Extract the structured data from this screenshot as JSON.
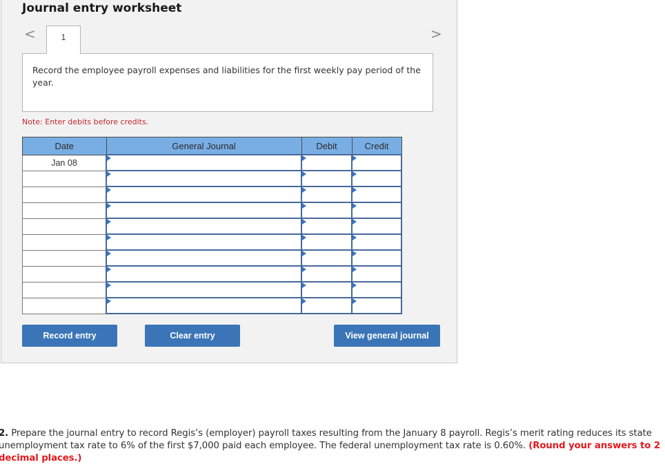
{
  "worksheet": {
    "title": "Journal entry worksheet",
    "nav": {
      "prev_icon": "chevron-left-icon",
      "next_icon": "chevron-right-icon",
      "prev_glyph": "<",
      "next_glyph": ">"
    },
    "tabs": [
      {
        "label": "1",
        "active": true
      }
    ],
    "instruction": "Record the employee payroll expenses and liabilities for the first weekly pay period of the year.",
    "note": "Note: Enter debits before credits.",
    "table": {
      "headers": {
        "date": "Date",
        "general_journal": "General Journal",
        "debit": "Debit",
        "credit": "Credit"
      },
      "rows": [
        {
          "date": "Jan 08",
          "account": "",
          "debit": "",
          "credit": ""
        },
        {
          "date": "",
          "account": "",
          "debit": "",
          "credit": ""
        },
        {
          "date": "",
          "account": "",
          "debit": "",
          "credit": ""
        },
        {
          "date": "",
          "account": "",
          "debit": "",
          "credit": ""
        },
        {
          "date": "",
          "account": "",
          "debit": "",
          "credit": ""
        },
        {
          "date": "",
          "account": "",
          "debit": "",
          "credit": ""
        },
        {
          "date": "",
          "account": "",
          "debit": "",
          "credit": ""
        },
        {
          "date": "",
          "account": "",
          "debit": "",
          "credit": ""
        },
        {
          "date": "",
          "account": "",
          "debit": "",
          "credit": ""
        },
        {
          "date": "",
          "account": "",
          "debit": "",
          "credit": ""
        }
      ]
    },
    "buttons": {
      "record": "Record entry",
      "clear": "Clear entry",
      "view": "View general journal"
    }
  },
  "question": {
    "number": "2.",
    "text": " Prepare the journal entry to record Regis’s (employer) payroll taxes resulting from the January 8 payroll. Regis’s merit rating reduces its state unemployment tax rate to 6% of the first $7,000 paid each employee. The federal unemployment tax rate is 0.60%. ",
    "emphasis": "(Round your answers to 2 decimal places.)"
  },
  "colors": {
    "header_blue": "#79aee5",
    "button_blue": "#3b75b8",
    "input_border": "#44699a",
    "note_red": "#c0282d",
    "emphasis_red": "#e3191e",
    "panel_bg": "#f2f2f2"
  }
}
